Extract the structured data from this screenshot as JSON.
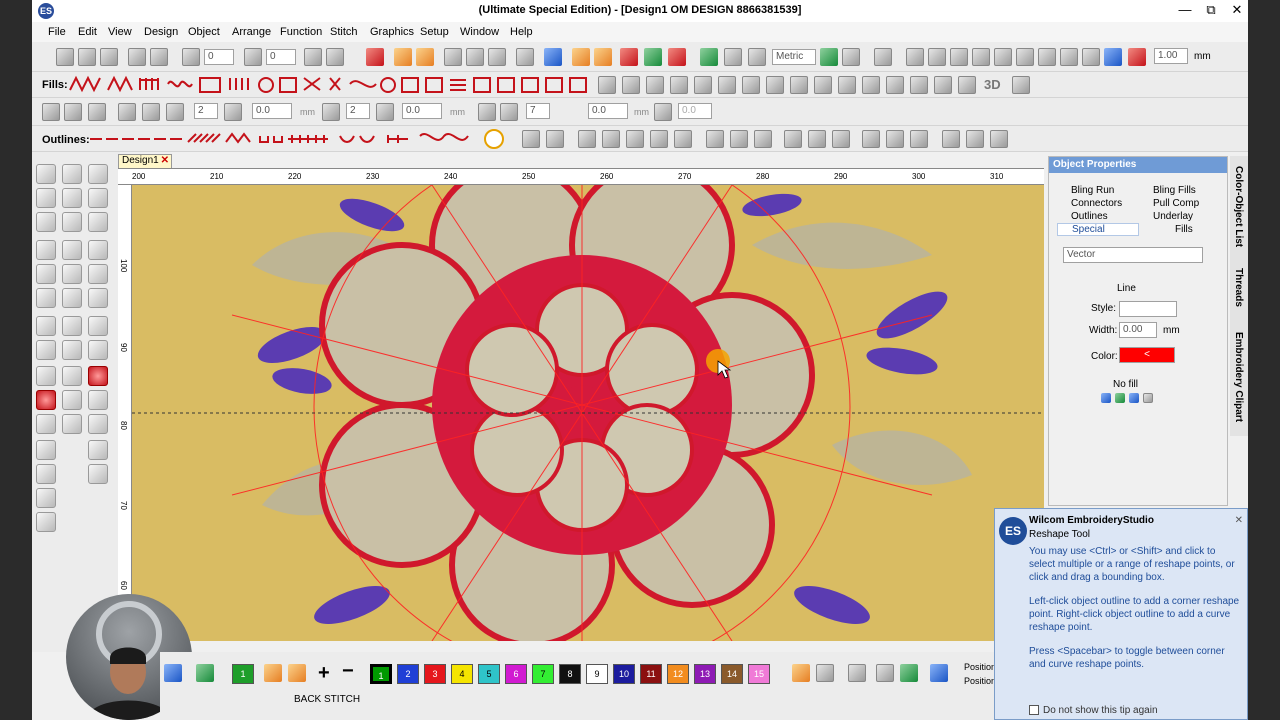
{
  "window": {
    "title": "(Ultimate Special Edition) - [Design1       OM DESIGN 8866381539]",
    "minimize": "—",
    "restore": "⧉",
    "close": "✕"
  },
  "menu": [
    "File",
    "Edit",
    "View",
    "Design",
    "Object",
    "Arrange",
    "Function",
    "Stitch",
    "Graphics",
    "Setup",
    "Window",
    "Help"
  ],
  "toolbar1": {
    "angle_value": "0",
    "angle_value2": "0",
    "units_select": "Metric",
    "size_value": "1.00",
    "size_unit": "mm"
  },
  "toolbar_fills": {
    "label": "Fills:",
    "three_d": "3D"
  },
  "toolbar3": {
    "v1": "2",
    "v2": "0.0",
    "v2_unit": "mm",
    "v3": "2",
    "v4": "0.0",
    "v4_unit": "mm",
    "v5": "7",
    "v6": "0.0",
    "v6_unit": "mm"
  },
  "toolbar_outlines": {
    "label": "Outlines:"
  },
  "document_tab": {
    "label": "Design1",
    "close": "✕"
  },
  "ruler": {
    "h": [
      "200",
      "210",
      "220",
      "230",
      "240",
      "250",
      "260",
      "270",
      "280",
      "290",
      "300",
      "310"
    ],
    "v": [
      "100",
      "90",
      "80",
      "70",
      "60"
    ]
  },
  "object_properties": {
    "title": "Object Properties",
    "tabs": [
      "Bling Run",
      "Bling Fills",
      "Connectors",
      "Pull Comp",
      "Outlines",
      "Underlay",
      "Special",
      "Fills"
    ],
    "type_select": "Vector",
    "line_label": "Line",
    "style_label": "Style:",
    "width_label": "Width:",
    "width_value": "0.00",
    "width_unit": "mm",
    "color_label": "Color:",
    "color_value": "<",
    "color_hex": "#ff0000",
    "fill_label": "No fill"
  },
  "side_tabs": [
    "Color-Object List",
    "Threads",
    "Embroidery Clipart"
  ],
  "tip": {
    "app": "Wilcom EmbroideryStudio",
    "tool": "Reshape Tool",
    "p1": "You may use <Ctrl> or <Shift> and click to select multiple or a range of reshape points, or click and drag a bounding box.",
    "p2": "Left-click object outline to add a corner reshape point. Right-click object outline to add a curve reshape point.",
    "p3": "Press <Spacebar> to toggle between corner and curve reshape points.",
    "checkbox": "Do not show this tip again"
  },
  "status": {
    "stitch_type": "BACK STITCH",
    "position1": "Position",
    "position2": "Position"
  },
  "swatches": [
    {
      "n": "1",
      "c": "#1e9e2a"
    },
    {
      "n": "1",
      "c": "#009900"
    },
    {
      "n": "2",
      "c": "#1f3fd6"
    },
    {
      "n": "3",
      "c": "#e5161c"
    },
    {
      "n": "4",
      "c": "#f5e400"
    },
    {
      "n": "5",
      "c": "#2fc4c9"
    },
    {
      "n": "6",
      "c": "#d11bd1"
    },
    {
      "n": "7",
      "c": "#33ee33"
    },
    {
      "n": "8",
      "c": "#111111"
    },
    {
      "n": "9",
      "c": "#ffffff"
    },
    {
      "n": "10",
      "c": "#1c1c9e"
    },
    {
      "n": "11",
      "c": "#8b1010"
    },
    {
      "n": "12",
      "c": "#f28c1e"
    },
    {
      "n": "13",
      "c": "#8e1bb4"
    },
    {
      "n": "14",
      "c": "#8a5a2b"
    },
    {
      "n": "15",
      "c": "#f07ad7"
    }
  ]
}
